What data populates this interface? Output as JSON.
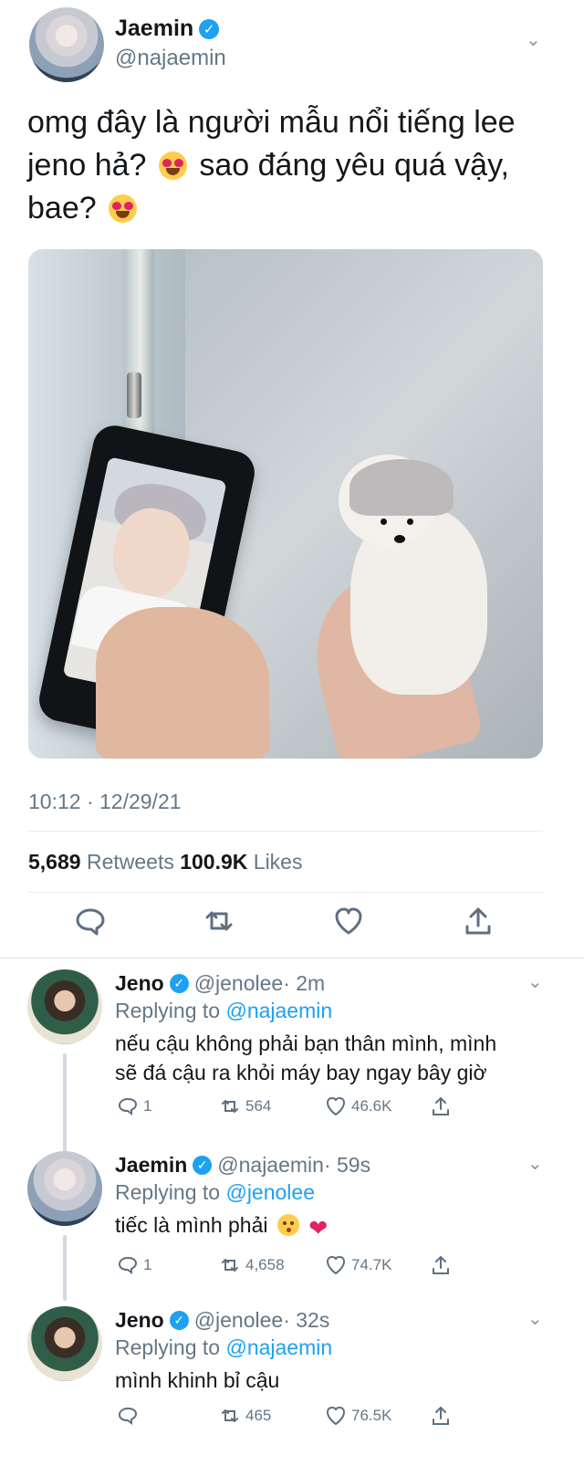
{
  "main_tweet": {
    "author_name": "Jaemin",
    "author_handle": "@najaemin",
    "text_line_1": "omg đây là người mẫu nổi tiếng lee",
    "text_line_2_start": "jeno hả?",
    "text_line_2_end": "sao đáng yêu quá vậy,",
    "text_line_3": "bae?",
    "time": "10:12 · 12/29/21",
    "retweets_count": "5,689",
    "retweets_label": "Retweets",
    "likes_count": "100.9K",
    "likes_label": "Likes"
  },
  "replies": [
    {
      "name": "Jeno",
      "handle": "@jenolee",
      "time": "· 2m",
      "replying_prefix": "Replying to",
      "replying_to": "@najaemin",
      "text_line_1": "nếu cậu không phải bạn thân mình, mình",
      "text_line_2": "sẽ đá cậu ra khỏi máy bay ngay bây giờ",
      "replies": "1",
      "retweets": "564",
      "likes": "46.6K"
    },
    {
      "name": "Jaemin",
      "handle": "@najaemin",
      "time": "· 59s",
      "replying_prefix": "Replying to",
      "replying_to": "@jenolee",
      "text_line_1": "tiếc là mình phải",
      "replies": "1",
      "retweets": "4,658",
      "likes": "74.7K"
    },
    {
      "name": "Jeno",
      "handle": "@jenolee",
      "time": "· 32s",
      "replying_prefix": "Replying to",
      "replying_to": "@najaemin",
      "text_line_1": "mình khinh bỉ cậu",
      "replies": "",
      "retweets": "465",
      "likes": "76.5K"
    }
  ],
  "icons": [
    "verified-badge-icon",
    "chevron-down-icon",
    "reply-icon",
    "retweet-icon",
    "like-icon",
    "share-icon"
  ],
  "colors": {
    "accent": "#1da1f2",
    "muted": "#657786",
    "text": "#14171a",
    "heart": "#e0245e"
  }
}
